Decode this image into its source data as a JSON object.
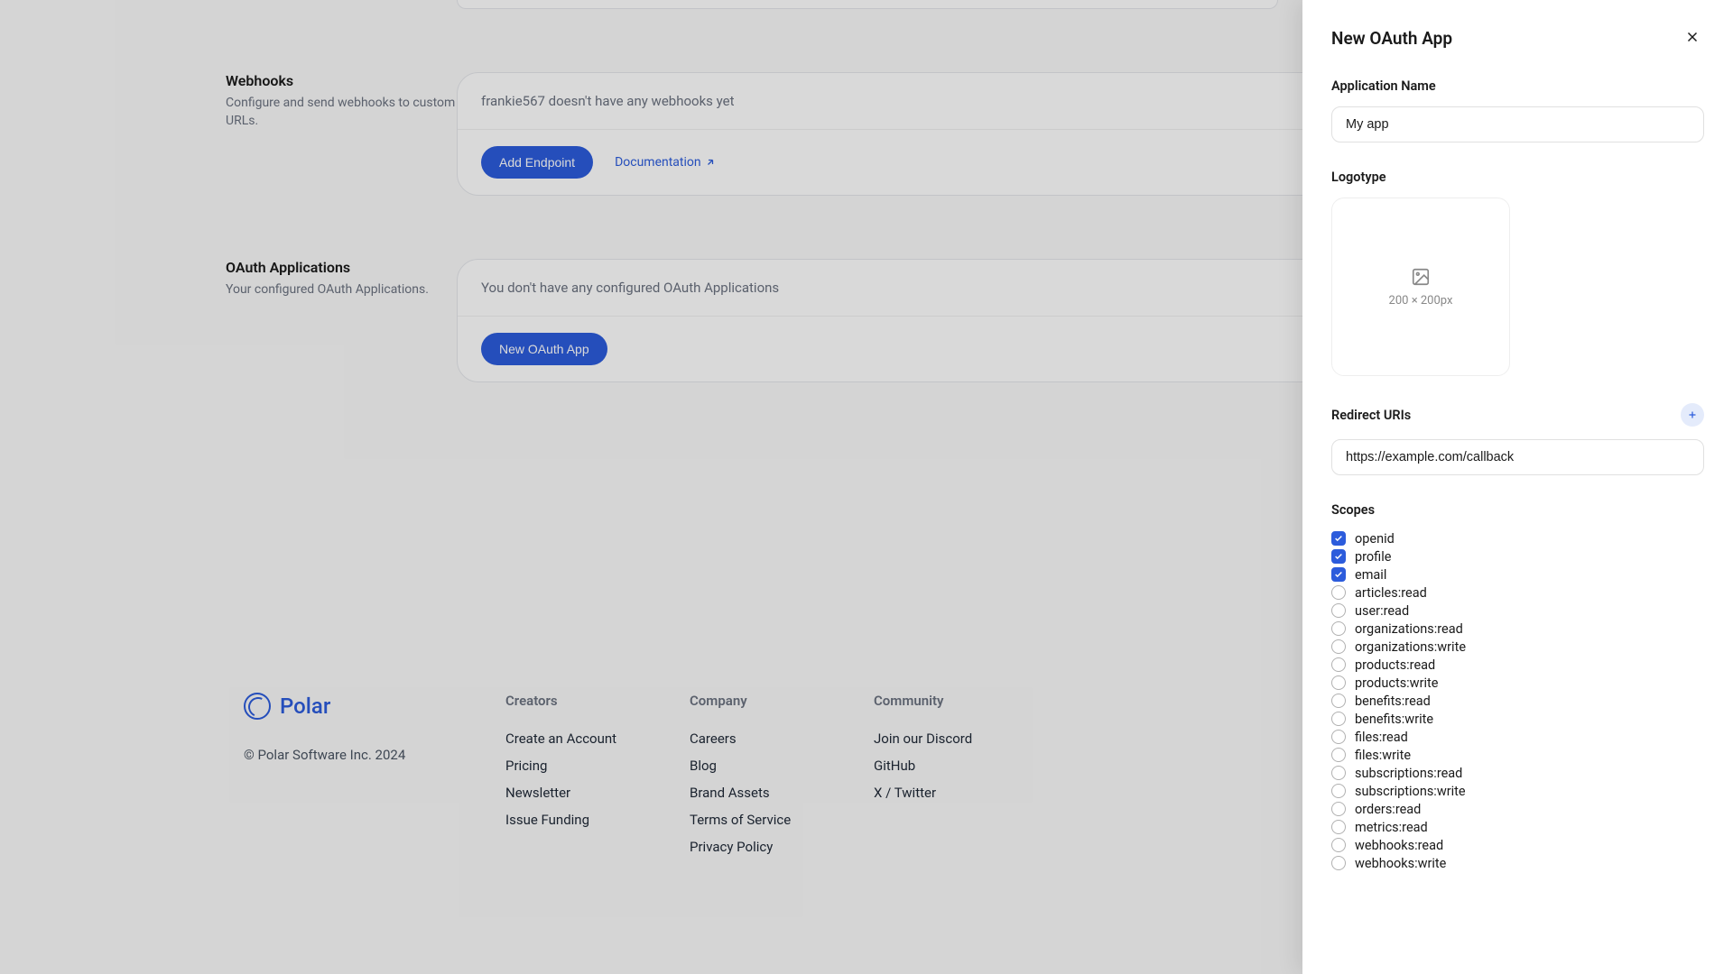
{
  "webhooks": {
    "title": "Webhooks",
    "desc": "Configure and send webhooks to custom URLs.",
    "empty_message": "frankie567 doesn't have any webhooks yet",
    "add_button": "Add Endpoint",
    "doc_link": "Documentation"
  },
  "oauth": {
    "title": "OAuth Applications",
    "desc": "Your configured OAuth Applications.",
    "empty_message": "You don't have any configured OAuth Applications",
    "new_button": "New OAuth App"
  },
  "footer": {
    "logo_text": "Polar",
    "copyright": "© Polar Software Inc. 2024",
    "creators": {
      "heading": "Creators",
      "create_account": "Create an Account",
      "pricing": "Pricing",
      "newsletter": "Newsletter",
      "issue_funding": "Issue Funding"
    },
    "company": {
      "heading": "Company",
      "careers": "Careers",
      "blog": "Blog",
      "brand_assets": "Brand Assets",
      "tos": "Terms of Service",
      "privacy": "Privacy Policy"
    },
    "community": {
      "heading": "Community",
      "discord": "Join our Discord",
      "github": "GitHub",
      "twitter": "X / Twitter"
    }
  },
  "drawer": {
    "title": "New OAuth App",
    "app_name_label": "Application Name",
    "app_name_value": "My app",
    "logotype_label": "Logotype",
    "logotype_size": "200 × 200px",
    "redirect_label": "Redirect URIs",
    "redirect_value": "https://example.com/callback",
    "scopes_label": "Scopes",
    "scopes": [
      {
        "name": "openid",
        "checked": true
      },
      {
        "name": "profile",
        "checked": true
      },
      {
        "name": "email",
        "checked": true
      },
      {
        "name": "articles:read",
        "checked": false
      },
      {
        "name": "user:read",
        "checked": false
      },
      {
        "name": "organizations:read",
        "checked": false
      },
      {
        "name": "organizations:write",
        "checked": false
      },
      {
        "name": "products:read",
        "checked": false
      },
      {
        "name": "products:write",
        "checked": false
      },
      {
        "name": "benefits:read",
        "checked": false
      },
      {
        "name": "benefits:write",
        "checked": false
      },
      {
        "name": "files:read",
        "checked": false
      },
      {
        "name": "files:write",
        "checked": false
      },
      {
        "name": "subscriptions:read",
        "checked": false
      },
      {
        "name": "subscriptions:write",
        "checked": false
      },
      {
        "name": "orders:read",
        "checked": false
      },
      {
        "name": "metrics:read",
        "checked": false
      },
      {
        "name": "webhooks:read",
        "checked": false
      },
      {
        "name": "webhooks:write",
        "checked": false
      }
    ]
  }
}
